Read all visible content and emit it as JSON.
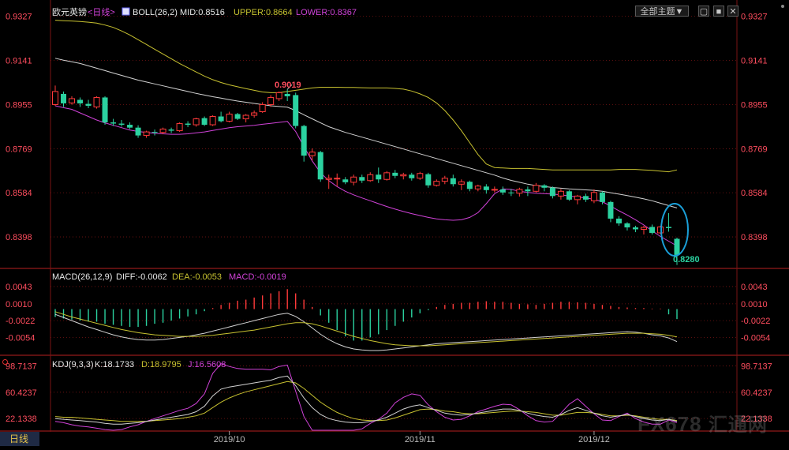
{
  "header": {
    "symbol": "欧元英镑",
    "period": "<日线>",
    "boll_label": "BOLL(26,2)",
    "mid": "MID:0.8516",
    "upper": "UPPER:0.8664",
    "lower": "LOWER:0.8367",
    "theme_select": "全部主题▼"
  },
  "colors": {
    "up": "#ff3a3a",
    "down": "#2bd2a0",
    "mid": "#d2d2d2",
    "upper": "#c8c230",
    "lower": "#d042d8",
    "price_axis": "#ff4d5e",
    "grid": "#7a1515"
  },
  "macd_header": {
    "label": "MACD(26,12,9)",
    "diff": "DIFF:-0.0062",
    "dea": "DEA:-0.0053",
    "macd": "MACD:-0.0019"
  },
  "kdj_header": {
    "label": "KDJ(9,3,3)",
    "k": "K:18.1733",
    "d": "D:18.9795",
    "j": "J:16.5608"
  },
  "period_tab": "日线",
  "watermark": {
    "a": "FX678",
    "b": "汇通网"
  },
  "annotations": {
    "high": "0.9019",
    "low": "0.8280"
  },
  "chart_data": {
    "type": "candlestick",
    "price_axis_ticks": [
      "0.9327",
      "0.9141",
      "0.8955",
      "0.8769",
      "0.8584",
      "0.8398"
    ],
    "price_axis_values": [
      0.9327,
      0.9141,
      0.8955,
      0.8769,
      0.8584,
      0.8398
    ],
    "ylim": [
      0.8272,
      0.9362
    ],
    "x_labels": [
      {
        "label": "2019/10",
        "index": 21
      },
      {
        "label": "2019/11",
        "index": 44
      },
      {
        "label": "2019/12",
        "index": 65
      }
    ],
    "candles": [
      {
        "o": 0.8955,
        "h": 0.9035,
        "l": 0.895,
        "c": 0.901
      },
      {
        "o": 0.9,
        "h": 0.901,
        "l": 0.8945,
        "c": 0.896
      },
      {
        "o": 0.8962,
        "h": 0.899,
        "l": 0.8955,
        "c": 0.898
      },
      {
        "o": 0.8975,
        "h": 0.8985,
        "l": 0.8945,
        "c": 0.896
      },
      {
        "o": 0.8958,
        "h": 0.8975,
        "l": 0.894,
        "c": 0.895
      },
      {
        "o": 0.8945,
        "h": 0.899,
        "l": 0.8938,
        "c": 0.8985
      },
      {
        "o": 0.8985,
        "h": 0.899,
        "l": 0.887,
        "c": 0.888
      },
      {
        "o": 0.888,
        "h": 0.8895,
        "l": 0.8865,
        "c": 0.8875
      },
      {
        "o": 0.8875,
        "h": 0.889,
        "l": 0.8862,
        "c": 0.887
      },
      {
        "o": 0.887,
        "h": 0.888,
        "l": 0.8852,
        "c": 0.8858
      },
      {
        "o": 0.8858,
        "h": 0.8868,
        "l": 0.8815,
        "c": 0.8825
      },
      {
        "o": 0.8825,
        "h": 0.8845,
        "l": 0.8815,
        "c": 0.884
      },
      {
        "o": 0.884,
        "h": 0.885,
        "l": 0.8825,
        "c": 0.8838
      },
      {
        "o": 0.8838,
        "h": 0.8858,
        "l": 0.883,
        "c": 0.8852
      },
      {
        "o": 0.885,
        "h": 0.8858,
        "l": 0.8835,
        "c": 0.8845
      },
      {
        "o": 0.8845,
        "h": 0.888,
        "l": 0.884,
        "c": 0.8875
      },
      {
        "o": 0.8875,
        "h": 0.8885,
        "l": 0.886,
        "c": 0.887
      },
      {
        "o": 0.887,
        "h": 0.89,
        "l": 0.8862,
        "c": 0.8895
      },
      {
        "o": 0.8898,
        "h": 0.8905,
        "l": 0.8865,
        "c": 0.887
      },
      {
        "o": 0.887,
        "h": 0.891,
        "l": 0.8865,
        "c": 0.8905
      },
      {
        "o": 0.8905,
        "h": 0.8925,
        "l": 0.888,
        "c": 0.8885
      },
      {
        "o": 0.8885,
        "h": 0.8925,
        "l": 0.888,
        "c": 0.8915
      },
      {
        "o": 0.8915,
        "h": 0.892,
        "l": 0.889,
        "c": 0.8895
      },
      {
        "o": 0.8895,
        "h": 0.8915,
        "l": 0.888,
        "c": 0.891
      },
      {
        "o": 0.891,
        "h": 0.893,
        "l": 0.89,
        "c": 0.892
      },
      {
        "o": 0.8925,
        "h": 0.8965,
        "l": 0.892,
        "c": 0.8955
      },
      {
        "o": 0.8955,
        "h": 0.8995,
        "l": 0.8945,
        "c": 0.8985
      },
      {
        "o": 0.898,
        "h": 0.901,
        "l": 0.897,
        "c": 0.9005
      },
      {
        "o": 0.9,
        "h": 0.9019,
        "l": 0.897,
        "c": 0.899
      },
      {
        "o": 0.8995,
        "h": 0.9005,
        "l": 0.8855,
        "c": 0.8865
      },
      {
        "o": 0.8865,
        "h": 0.887,
        "l": 0.8715,
        "c": 0.874
      },
      {
        "o": 0.874,
        "h": 0.877,
        "l": 0.872,
        "c": 0.8755
      },
      {
        "o": 0.8755,
        "h": 0.876,
        "l": 0.863,
        "c": 0.864
      },
      {
        "o": 0.864,
        "h": 0.866,
        "l": 0.86,
        "c": 0.8645
      },
      {
        "o": 0.8645,
        "h": 0.8665,
        "l": 0.861,
        "c": 0.8645
      },
      {
        "o": 0.864,
        "h": 0.865,
        "l": 0.862,
        "c": 0.8628
      },
      {
        "o": 0.8628,
        "h": 0.866,
        "l": 0.8615,
        "c": 0.865
      },
      {
        "o": 0.865,
        "h": 0.866,
        "l": 0.8625,
        "c": 0.8635
      },
      {
        "o": 0.8635,
        "h": 0.867,
        "l": 0.863,
        "c": 0.866
      },
      {
        "o": 0.866,
        "h": 0.869,
        "l": 0.8625,
        "c": 0.864
      },
      {
        "o": 0.864,
        "h": 0.8675,
        "l": 0.8635,
        "c": 0.8668
      },
      {
        "o": 0.8668,
        "h": 0.868,
        "l": 0.8645,
        "c": 0.8655
      },
      {
        "o": 0.8655,
        "h": 0.8668,
        "l": 0.864,
        "c": 0.866
      },
      {
        "o": 0.866,
        "h": 0.8668,
        "l": 0.8635,
        "c": 0.8645
      },
      {
        "o": 0.8645,
        "h": 0.8672,
        "l": 0.8638,
        "c": 0.8665
      },
      {
        "o": 0.8662,
        "h": 0.8668,
        "l": 0.8605,
        "c": 0.8615
      },
      {
        "o": 0.8615,
        "h": 0.864,
        "l": 0.861,
        "c": 0.8632
      },
      {
        "o": 0.8632,
        "h": 0.8655,
        "l": 0.862,
        "c": 0.8645
      },
      {
        "o": 0.8645,
        "h": 0.866,
        "l": 0.861,
        "c": 0.862
      },
      {
        "o": 0.862,
        "h": 0.864,
        "l": 0.8595,
        "c": 0.863
      },
      {
        "o": 0.863,
        "h": 0.8635,
        "l": 0.859,
        "c": 0.86
      },
      {
        "o": 0.86,
        "h": 0.8618,
        "l": 0.859,
        "c": 0.8612
      },
      {
        "o": 0.861,
        "h": 0.862,
        "l": 0.858,
        "c": 0.8595
      },
      {
        "o": 0.8595,
        "h": 0.861,
        "l": 0.8585,
        "c": 0.8598
      },
      {
        "o": 0.8598,
        "h": 0.861,
        "l": 0.8575,
        "c": 0.8585
      },
      {
        "o": 0.8585,
        "h": 0.86,
        "l": 0.857,
        "c": 0.8582
      },
      {
        "o": 0.8582,
        "h": 0.8605,
        "l": 0.8568,
        "c": 0.8598
      },
      {
        "o": 0.8598,
        "h": 0.861,
        "l": 0.857,
        "c": 0.859
      },
      {
        "o": 0.859,
        "h": 0.8625,
        "l": 0.8585,
        "c": 0.8615
      },
      {
        "o": 0.8615,
        "h": 0.862,
        "l": 0.859,
        "c": 0.8605
      },
      {
        "o": 0.8605,
        "h": 0.861,
        "l": 0.856,
        "c": 0.857
      },
      {
        "o": 0.857,
        "h": 0.86,
        "l": 0.8555,
        "c": 0.859
      },
      {
        "o": 0.859,
        "h": 0.8595,
        "l": 0.855,
        "c": 0.8555
      },
      {
        "o": 0.8555,
        "h": 0.8575,
        "l": 0.8535,
        "c": 0.857
      },
      {
        "o": 0.857,
        "h": 0.858,
        "l": 0.8545,
        "c": 0.8555
      },
      {
        "o": 0.855,
        "h": 0.8598,
        "l": 0.854,
        "c": 0.8585
      },
      {
        "o": 0.8585,
        "h": 0.859,
        "l": 0.8535,
        "c": 0.8545
      },
      {
        "o": 0.8545,
        "h": 0.855,
        "l": 0.846,
        "c": 0.8475
      },
      {
        "o": 0.8475,
        "h": 0.8485,
        "l": 0.8445,
        "c": 0.8455
      },
      {
        "o": 0.8455,
        "h": 0.846,
        "l": 0.8425,
        "c": 0.8438
      },
      {
        "o": 0.8438,
        "h": 0.8445,
        "l": 0.8418,
        "c": 0.843
      },
      {
        "o": 0.843,
        "h": 0.8445,
        "l": 0.8408,
        "c": 0.8438
      },
      {
        "o": 0.844,
        "h": 0.845,
        "l": 0.8408,
        "c": 0.8415
      },
      {
        "o": 0.8415,
        "h": 0.8445,
        "l": 0.841,
        "c": 0.844
      },
      {
        "o": 0.844,
        "h": 0.8498,
        "l": 0.842,
        "c": 0.8435
      },
      {
        "o": 0.839,
        "h": 0.8395,
        "l": 0.828,
        "c": 0.8322
      }
    ],
    "boll_upper": [
      0.931,
      0.9308,
      0.9307,
      0.9305,
      0.9302,
      0.9298,
      0.929,
      0.928,
      0.9265,
      0.9248,
      0.9228,
      0.9208,
      0.9188,
      0.9168,
      0.9148,
      0.9128,
      0.911,
      0.9092,
      0.9075,
      0.906,
      0.9048,
      0.9038,
      0.903,
      0.9022,
      0.9015,
      0.9008,
      0.9005,
      0.9005,
      0.901,
      0.9015,
      0.902,
      0.9025,
      0.9028,
      0.9028,
      0.9028,
      0.9027,
      0.9027,
      0.9026,
      0.9025,
      0.9025,
      0.9025,
      0.9023,
      0.902,
      0.9012,
      0.9,
      0.8985,
      0.8962,
      0.893,
      0.889,
      0.8845,
      0.8795,
      0.8745,
      0.8705,
      0.869,
      0.8688,
      0.8686,
      0.8686,
      0.8686,
      0.8684,
      0.8682,
      0.868,
      0.868,
      0.868,
      0.868,
      0.868,
      0.868,
      0.868,
      0.868,
      0.8682,
      0.8682,
      0.8682,
      0.868,
      0.8678,
      0.8675,
      0.8672,
      0.868
    ],
    "boll_mid": [
      0.915,
      0.9142,
      0.9135,
      0.9128,
      0.9118,
      0.9108,
      0.9098,
      0.9088,
      0.9078,
      0.9068,
      0.9058,
      0.905,
      0.9042,
      0.9034,
      0.9026,
      0.9018,
      0.901,
      0.9002,
      0.8995,
      0.8988,
      0.8982,
      0.8976,
      0.897,
      0.8965,
      0.896,
      0.8955,
      0.895,
      0.8947,
      0.8944,
      0.893,
      0.8912,
      0.8895,
      0.8878,
      0.8862,
      0.885,
      0.8838,
      0.8828,
      0.8818,
      0.8808,
      0.8798,
      0.8788,
      0.8778,
      0.8768,
      0.8758,
      0.8748,
      0.8738,
      0.8728,
      0.8718,
      0.8708,
      0.8698,
      0.8688,
      0.8678,
      0.8668,
      0.8658,
      0.8646,
      0.8636,
      0.8628,
      0.862,
      0.8614,
      0.861,
      0.8606,
      0.8603,
      0.86,
      0.8598,
      0.8596,
      0.8594,
      0.859,
      0.8584,
      0.8578,
      0.8572,
      0.8565,
      0.8558,
      0.855,
      0.854,
      0.853,
      0.852
    ],
    "boll_lower": [
      0.895,
      0.8942,
      0.8935,
      0.892,
      0.8905,
      0.889,
      0.8878,
      0.8868,
      0.8858,
      0.8848,
      0.8842,
      0.8838,
      0.8834,
      0.8832,
      0.883,
      0.883,
      0.8832,
      0.8836,
      0.884,
      0.8846,
      0.8852,
      0.8858,
      0.8862,
      0.8865,
      0.8868,
      0.8872,
      0.8876,
      0.888,
      0.8884,
      0.8842,
      0.8778,
      0.8718,
      0.8668,
      0.8635,
      0.861,
      0.859,
      0.8575,
      0.8562,
      0.855,
      0.8538,
      0.8526,
      0.8515,
      0.8505,
      0.8496,
      0.8488,
      0.848,
      0.8474,
      0.847,
      0.8468,
      0.847,
      0.848,
      0.85,
      0.8538,
      0.858,
      0.86,
      0.8598,
      0.859,
      0.8585,
      0.8582,
      0.858,
      0.8578,
      0.8575,
      0.857,
      0.8566,
      0.8562,
      0.8556,
      0.8546,
      0.8528,
      0.8508,
      0.849,
      0.847,
      0.8448,
      0.8424,
      0.84,
      0.838,
      0.836
    ],
    "macd": {
      "axis_ticks": [
        "0.0043",
        "0.0010",
        "-0.0022",
        "-0.0054"
      ],
      "axis_values": [
        0.0043,
        0.001,
        -0.0022,
        -0.0054
      ],
      "ylim": [
        -0.0085,
        0.0073
      ],
      "hist": [
        -0.0015,
        -0.0018,
        -0.002,
        -0.0022,
        -0.0024,
        -0.0024,
        -0.0028,
        -0.003,
        -0.0032,
        -0.0034,
        -0.0034,
        -0.0032,
        -0.0028,
        -0.0026,
        -0.0022,
        -0.0018,
        -0.0014,
        -0.001,
        -0.0004,
        0.0002,
        0.0008,
        0.0012,
        0.0016,
        0.0018,
        0.0022,
        0.0026,
        0.003,
        0.0034,
        0.0038,
        0.003,
        0.0018,
        0.0004,
        -0.0012,
        -0.0026,
        -0.004,
        -0.0052,
        -0.006,
        -0.006,
        -0.0054,
        -0.0048,
        -0.004,
        -0.0032,
        -0.0024,
        -0.0016,
        -0.0008,
        -0.0002,
        0.0004,
        0.0008,
        0.001,
        0.0012,
        0.0012,
        0.0014,
        0.0015,
        0.0014,
        0.0014,
        0.0012,
        0.001,
        0.0009,
        0.0008,
        0.001,
        0.0012,
        0.0014,
        0.0014,
        0.0013,
        0.0012,
        0.001,
        0.0008,
        0.0006,
        0.0004,
        0.0003,
        0.0002,
        0.0002,
        0.0001,
        0.0001,
        -0.001,
        -0.0019
      ],
      "diff": [
        -0.001,
        -0.0016,
        -0.0022,
        -0.0028,
        -0.0034,
        -0.0039,
        -0.0044,
        -0.0049,
        -0.0053,
        -0.0056,
        -0.0058,
        -0.0059,
        -0.0059,
        -0.0058,
        -0.0056,
        -0.0054,
        -0.0052,
        -0.0049,
        -0.0046,
        -0.0042,
        -0.0038,
        -0.0034,
        -0.003,
        -0.0026,
        -0.0022,
        -0.0018,
        -0.0014,
        -0.001,
        -0.0008,
        -0.0014,
        -0.0024,
        -0.0036,
        -0.0048,
        -0.0058,
        -0.0066,
        -0.0072,
        -0.0076,
        -0.0078,
        -0.0079,
        -0.0079,
        -0.0078,
        -0.0076,
        -0.0074,
        -0.0072,
        -0.007,
        -0.0068,
        -0.0066,
        -0.0065,
        -0.0064,
        -0.0063,
        -0.0062,
        -0.0061,
        -0.006,
        -0.0059,
        -0.0058,
        -0.0057,
        -0.0056,
        -0.0055,
        -0.0054,
        -0.0053,
        -0.0052,
        -0.0051,
        -0.005,
        -0.0049,
        -0.0048,
        -0.0047,
        -0.0046,
        -0.0045,
        -0.0044,
        -0.0043,
        -0.0044,
        -0.0046,
        -0.0049,
        -0.0051,
        -0.0055,
        -0.0062
      ],
      "dea": [
        -0.0005,
        -0.001,
        -0.0015,
        -0.0019,
        -0.0023,
        -0.0027,
        -0.0031,
        -0.0035,
        -0.0039,
        -0.0042,
        -0.0045,
        -0.0047,
        -0.0049,
        -0.005,
        -0.0051,
        -0.0052,
        -0.0052,
        -0.0052,
        -0.0051,
        -0.005,
        -0.0048,
        -0.0046,
        -0.0044,
        -0.0042,
        -0.004,
        -0.0037,
        -0.0034,
        -0.0031,
        -0.0028,
        -0.0026,
        -0.0026,
        -0.0028,
        -0.0032,
        -0.0037,
        -0.0042,
        -0.0047,
        -0.0052,
        -0.0056,
        -0.006,
        -0.0063,
        -0.0066,
        -0.0068,
        -0.0069,
        -0.007,
        -0.007,
        -0.007,
        -0.0069,
        -0.0068,
        -0.0067,
        -0.0066,
        -0.0065,
        -0.0064,
        -0.0063,
        -0.0062,
        -0.0061,
        -0.006,
        -0.0059,
        -0.0058,
        -0.0057,
        -0.0056,
        -0.0055,
        -0.0054,
        -0.0053,
        -0.0052,
        -0.0051,
        -0.005,
        -0.0049,
        -0.0048,
        -0.0047,
        -0.0046,
        -0.0046,
        -0.0046,
        -0.0047,
        -0.0048,
        -0.005,
        -0.0053
      ]
    },
    "kdj": {
      "axis_ticks": [
        "98.7137",
        "60.4237",
        "22.1338"
      ],
      "axis_values": [
        98.7137,
        60.4237,
        22.1338
      ],
      "ylim": [
        5,
        112
      ],
      "k": [
        22,
        21,
        20,
        19,
        18,
        17,
        15,
        14,
        14,
        15,
        16,
        18,
        20,
        22,
        24,
        26,
        28,
        32,
        40,
        55,
        65,
        68,
        70,
        72,
        74,
        76,
        78,
        82,
        84,
        70,
        52,
        38,
        28,
        22,
        19,
        17,
        16,
        16,
        18,
        20,
        24,
        30,
        36,
        40,
        42,
        38,
        34,
        30,
        28,
        27,
        28,
        30,
        32,
        34,
        36,
        36,
        34,
        30,
        27,
        25,
        24,
        28,
        34,
        38,
        34,
        30,
        26,
        24,
        26,
        28,
        25,
        22,
        20,
        19,
        21,
        18
      ],
      "d": [
        25,
        24,
        24,
        23,
        22,
        21,
        20,
        19,
        18,
        18,
        18,
        18,
        19,
        20,
        21,
        22,
        24,
        26,
        30,
        38,
        46,
        52,
        57,
        61,
        64,
        67,
        70,
        73,
        76,
        74,
        66,
        56,
        46,
        38,
        31,
        26,
        22,
        20,
        19,
        19,
        20,
        23,
        27,
        31,
        35,
        36,
        35,
        33,
        32,
        30,
        29,
        29,
        30,
        31,
        32,
        33,
        33,
        32,
        31,
        29,
        27,
        27,
        29,
        31,
        31,
        30,
        28,
        26,
        26,
        27,
        26,
        24,
        22,
        21,
        21,
        19
      ],
      "j": [
        18,
        16,
        13,
        11,
        10,
        8,
        6,
        5,
        6,
        10,
        13,
        18,
        22,
        26,
        30,
        34,
        37,
        44,
        58,
        88,
        102,
        98,
        95,
        94,
        94,
        94,
        93,
        98,
        100,
        62,
        25,
        2,
        -5,
        -8,
        -6,
        0,
        3,
        7,
        15,
        21,
        30,
        45,
        53,
        58,
        56,
        42,
        32,
        24,
        20,
        21,
        26,
        32,
        36,
        40,
        43,
        42,
        35,
        26,
        19,
        17,
        18,
        30,
        43,
        51,
        40,
        29,
        20,
        19,
        25,
        30,
        22,
        17,
        14,
        14,
        20,
        16
      ]
    }
  }
}
